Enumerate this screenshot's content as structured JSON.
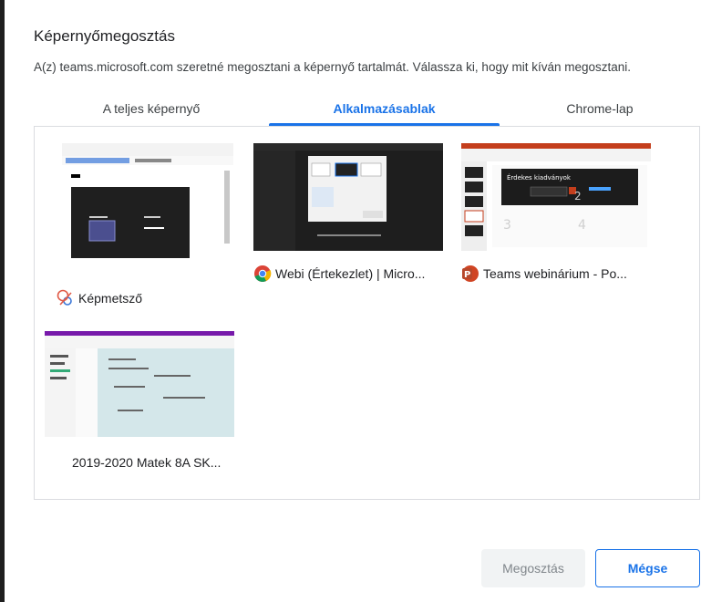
{
  "dialog": {
    "title": "Képernyőmegosztás",
    "subtitle": "A(z) teams.microsoft.com szeretné megosztani a képernyő tartalmát. Válassza ki, hogy mit kíván megosztani."
  },
  "tabs": [
    {
      "label": "A teljes képernyő",
      "active": false
    },
    {
      "label": "Alkalmazásablak",
      "active": true
    },
    {
      "label": "Chrome-lap",
      "active": false
    }
  ],
  "windows": [
    {
      "label": "Képmetsző",
      "icon": "snipping-tool-icon"
    },
    {
      "label": "Webi (Értekezlet) | Micro...",
      "icon": "chrome-icon"
    },
    {
      "label": "Teams webinárium - Po...",
      "icon": "powerpoint-icon"
    },
    {
      "label": "2019-2020 Matek 8A SK...",
      "icon": "onenote-icon"
    }
  ],
  "thumbnail_text": {
    "slide_title": "Érdekes kiadványok",
    "slide_num_3": "3",
    "slide_num_4": "4",
    "slide_num_2": "2",
    "ppt_icon_letter": "P"
  },
  "buttons": {
    "share": "Megosztás",
    "cancel": "Mégse"
  },
  "colors": {
    "accent": "#1a73e8",
    "disabled_bg": "#f1f3f4",
    "disabled_text": "#80868b"
  }
}
